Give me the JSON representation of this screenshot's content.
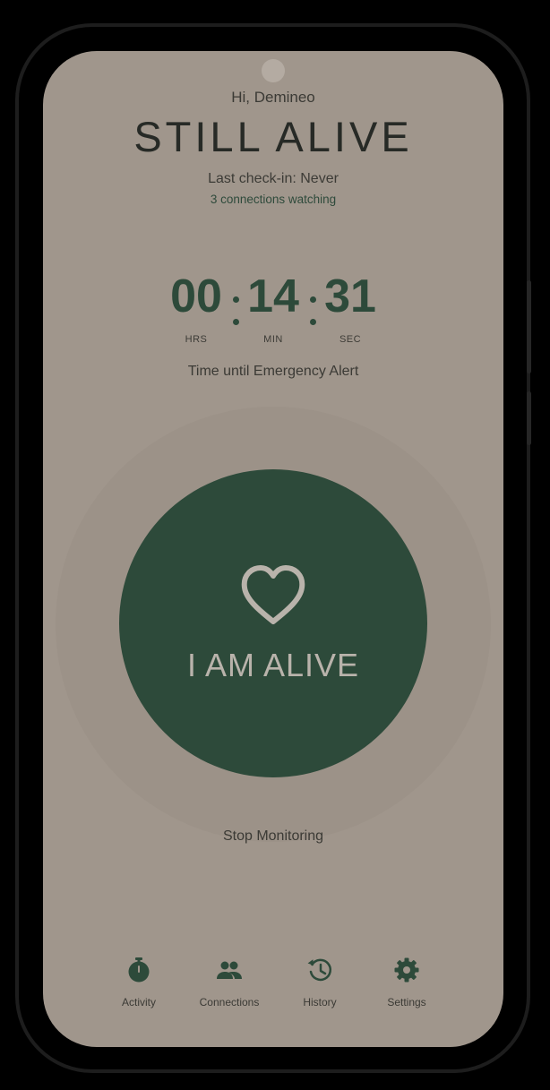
{
  "header": {
    "greeting": "Hi, Demineo",
    "title": "STILL ALIVE",
    "last_checkin": "Last check-in: Never",
    "connections_watching": "3 connections watching"
  },
  "timer": {
    "hours": "00",
    "minutes": "14",
    "seconds": "31",
    "hours_label": "HRS",
    "minutes_label": "MIN",
    "seconds_label": "SEC",
    "caption": "Time until Emergency Alert"
  },
  "main_button": {
    "label": "I AM ALIVE",
    "icon": "heart-icon"
  },
  "stop_monitoring_label": "Stop Monitoring",
  "bottom_nav": {
    "items": [
      {
        "label": "Activity",
        "icon": "stopwatch-icon"
      },
      {
        "label": "Connections",
        "icon": "people-icon"
      },
      {
        "label": "History",
        "icon": "history-icon"
      },
      {
        "label": "Settings",
        "icon": "gear-icon"
      }
    ]
  },
  "colors": {
    "background": "#a0968c",
    "accent_green": "#2d4a3a",
    "text_dark": "#272a26",
    "button_text": "#b9b3ab"
  }
}
